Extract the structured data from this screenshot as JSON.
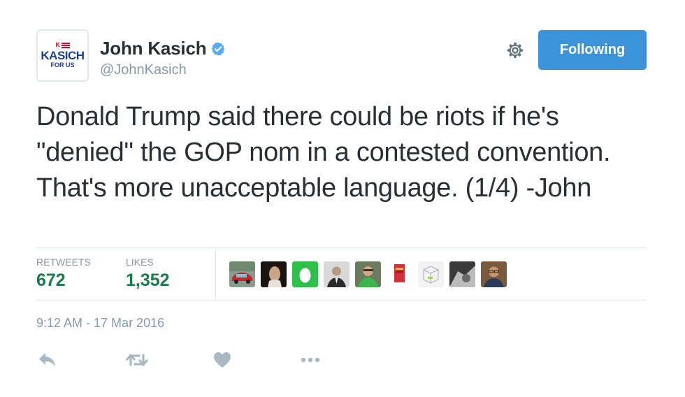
{
  "profile": {
    "avatar_line1": "KASICH",
    "avatar_line2": "FOR US",
    "avatar_mark": "K",
    "display_name": "John Kasich",
    "handle": "@JohnKasich",
    "verified_icon": "verified-badge-icon"
  },
  "header": {
    "gear_icon": "gear-icon",
    "follow_label": "Following"
  },
  "tweet": {
    "text": "Donald Trump said there could be riots if he's \"denied\" the GOP nom in a contested convention. That's more unacceptable language. (1/4) -John",
    "timestamp": "9:12 AM - 17 Mar 2016"
  },
  "stats": {
    "retweets_label": "RETWEETS",
    "retweets_count": "672",
    "likes_label": "LIKES",
    "likes_count": "1,352",
    "liker_avatars": [
      "car-photo",
      "person-photo",
      "default-egg-avatar",
      "person-suit-photo",
      "person-green-shirt-photo",
      "red-book-avatar",
      "cube-graphic-avatar",
      "dark-photo",
      "person-glasses-photo"
    ]
  },
  "actions": {
    "reply_icon": "reply-icon",
    "retweet_icon": "retweet-icon",
    "like_icon": "heart-icon",
    "more_icon": "more-dots-icon"
  },
  "colors": {
    "accent": "#3b94d9",
    "count": "#1a7a4e",
    "muted": "#8899a6",
    "text": "#292f33",
    "border": "#e1e8ed"
  }
}
